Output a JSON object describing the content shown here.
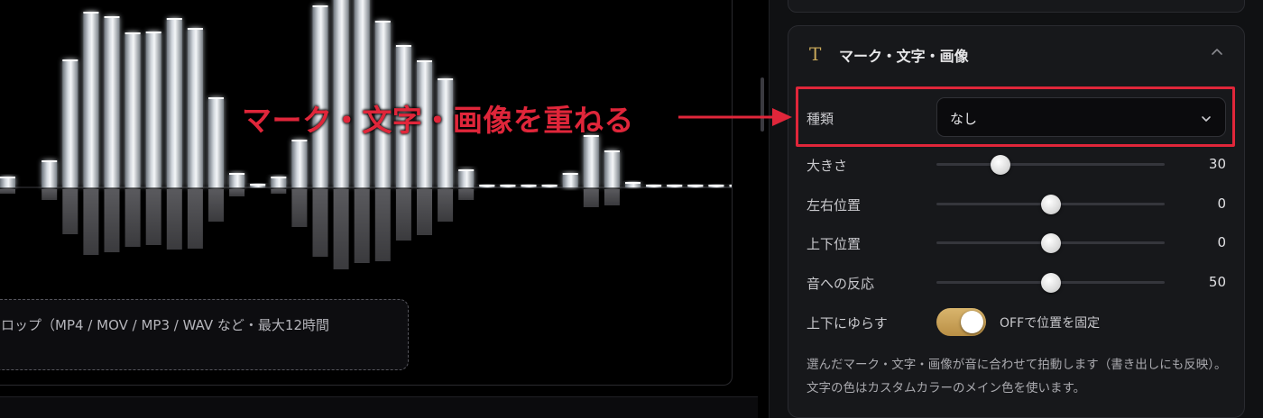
{
  "visualizer": {
    "dropzone_text": "ロップ（MP4 / MOV / MP3 / WAV など・最大12時間",
    "bars_up": [
      12,
      0,
      30,
      142,
      195,
      190,
      172,
      173,
      188,
      177,
      100,
      16,
      4,
      12,
      53,
      202,
      225,
      218,
      185,
      158,
      141,
      121,
      20,
      3,
      3,
      3,
      3,
      16,
      58,
      41,
      6,
      3,
      3,
      3,
      3,
      3
    ],
    "bars_down": [
      5,
      0,
      12,
      50,
      73,
      70,
      64,
      62,
      67,
      66,
      36,
      8,
      0,
      5,
      42,
      75,
      89,
      82,
      80,
      57,
      51,
      36,
      12,
      0,
      0,
      0,
      0,
      0,
      20,
      18,
      0,
      0,
      0,
      0,
      0,
      0
    ]
  },
  "panel": {
    "card_icon": "T",
    "card_title": "マーク・文字・画像",
    "type_label": "種類",
    "type_value": "なし",
    "sliders": [
      {
        "label": "大きさ",
        "value": "30",
        "fraction": 0.28
      },
      {
        "label": "左右位置",
        "value": "0",
        "fraction": 0.5
      },
      {
        "label": "上下位置",
        "value": "0",
        "fraction": 0.5
      },
      {
        "label": "音への反応",
        "value": "50",
        "fraction": 0.5
      }
    ],
    "sway_label": "上下にゆらす",
    "sway_toggle_text": "OFFで位置を固定",
    "sway_on": true,
    "help_text": "選んだマーク・文字・画像が音に合わせて拍動します（書き出しにも反映）。文字の色はカスタムカラーのメイン色を使います。"
  },
  "annotation": {
    "text": "マーク・文字・画像を重ねる",
    "color": "#e0263a"
  },
  "colors": {
    "accent_gold": "#c9a85a",
    "toggle_gold": "#d9b56d",
    "panel_bg": "#101113",
    "card_bg": "#17181b"
  },
  "icons": {
    "card": "text-t-icon",
    "collapse": "chevron-up-icon",
    "select": "chevron-down-icon"
  }
}
